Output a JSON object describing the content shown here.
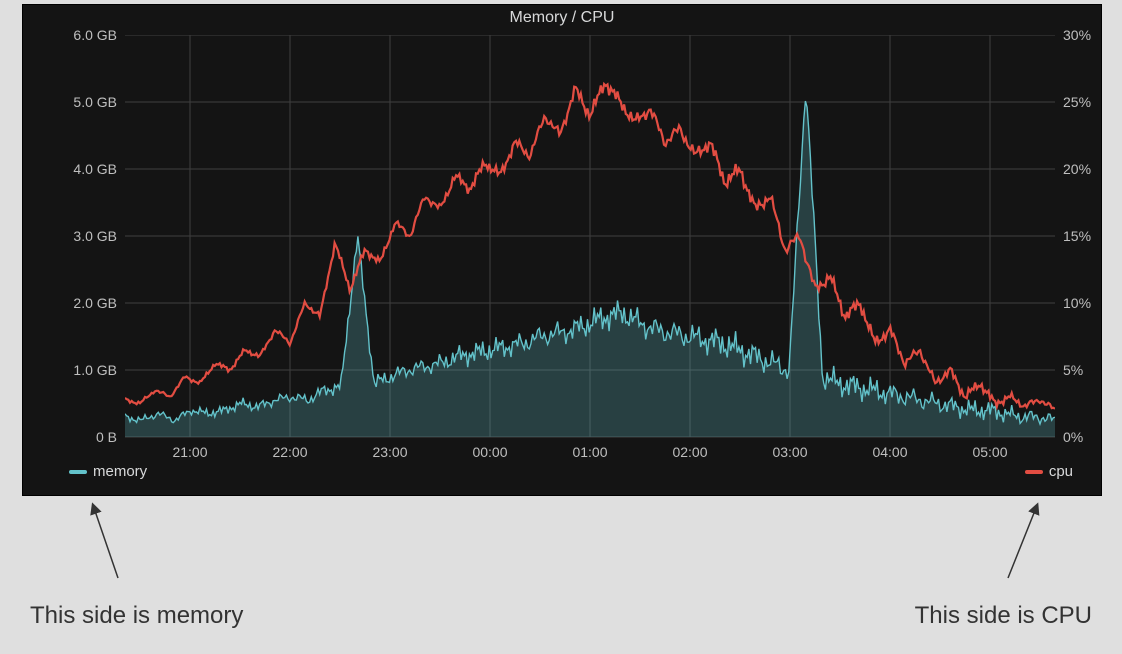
{
  "panel": {
    "title": "Memory / CPU",
    "legend": {
      "left_label": "memory",
      "right_label": "cpu"
    },
    "colors": {
      "memory": "#63c2ca",
      "cpu": "#e24d42",
      "text": "#d8d9da",
      "grid": "#3f3f3f",
      "panel_bg": "#141414"
    },
    "y_left_ticks": [
      "0 B",
      "1.0 GB",
      "2.0 GB",
      "3.0 GB",
      "4.0 GB",
      "5.0 GB",
      "6.0 GB"
    ],
    "y_right_ticks": [
      "0%",
      "5%",
      "10%",
      "15%",
      "20%",
      "25%",
      "30%"
    ],
    "x_ticks": [
      "21:00",
      "22:00",
      "23:00",
      "00:00",
      "01:00",
      "02:00",
      "03:00",
      "04:00",
      "05:00"
    ]
  },
  "captions": {
    "left": "This side is memory",
    "right": "This side is CPU"
  },
  "chart_data": {
    "type": "line",
    "title": "Memory / CPU",
    "x_range_hours": [
      "20:20",
      "05:40"
    ],
    "series": [
      {
        "name": "memory",
        "axis": "left",
        "unit": "GB",
        "ylim": [
          0,
          6
        ],
        "fill": true,
        "color": "#63c2ca",
        "sample_interval_min": 10,
        "values": [
          0.3,
          0.25,
          0.35,
          0.25,
          0.4,
          0.35,
          0.4,
          0.5,
          0.45,
          0.55,
          0.6,
          0.55,
          0.7,
          0.75,
          3.0,
          0.8,
          0.9,
          1.0,
          1.05,
          1.1,
          1.2,
          1.25,
          1.3,
          1.35,
          1.4,
          1.5,
          1.55,
          1.6,
          1.7,
          1.8,
          1.85,
          1.7,
          1.6,
          1.55,
          1.5,
          1.45,
          1.4,
          1.3,
          1.2,
          1.1,
          1.0,
          5.3,
          0.9,
          0.8,
          0.75,
          0.7,
          0.65,
          0.6,
          0.55,
          0.5,
          0.45,
          0.4,
          0.4,
          0.35,
          0.3,
          0.3,
          0.25
        ]
      },
      {
        "name": "cpu",
        "axis": "right",
        "unit": "%",
        "ylim": [
          0,
          30
        ],
        "fill": false,
        "color": "#e24d42",
        "sample_interval_min": 10,
        "values": [
          2.8,
          2.5,
          3.5,
          3.0,
          4.5,
          4.0,
          5.5,
          5.0,
          6.5,
          6.0,
          8.0,
          7.0,
          10.0,
          9.0,
          14.5,
          11.0,
          14.0,
          13.0,
          16.0,
          15.0,
          18.0,
          17.0,
          19.5,
          18.5,
          20.5,
          19.5,
          22.0,
          21.0,
          24.0,
          22.5,
          26.0,
          24.0,
          26.5,
          25.0,
          23.5,
          24.5,
          22.0,
          23.0,
          21.0,
          22.0,
          19.0,
          20.0,
          17.0,
          18.0,
          14.0,
          15.0,
          11.0,
          12.0,
          9.0,
          10.0,
          7.0,
          8.0,
          5.5,
          6.5,
          4.0,
          5.0,
          3.0,
          4.0,
          2.5,
          3.0,
          2.3,
          2.8,
          2.0
        ]
      }
    ],
    "x_ticks": [
      "21:00",
      "22:00",
      "23:00",
      "00:00",
      "01:00",
      "02:00",
      "03:00",
      "04:00",
      "05:00"
    ]
  }
}
